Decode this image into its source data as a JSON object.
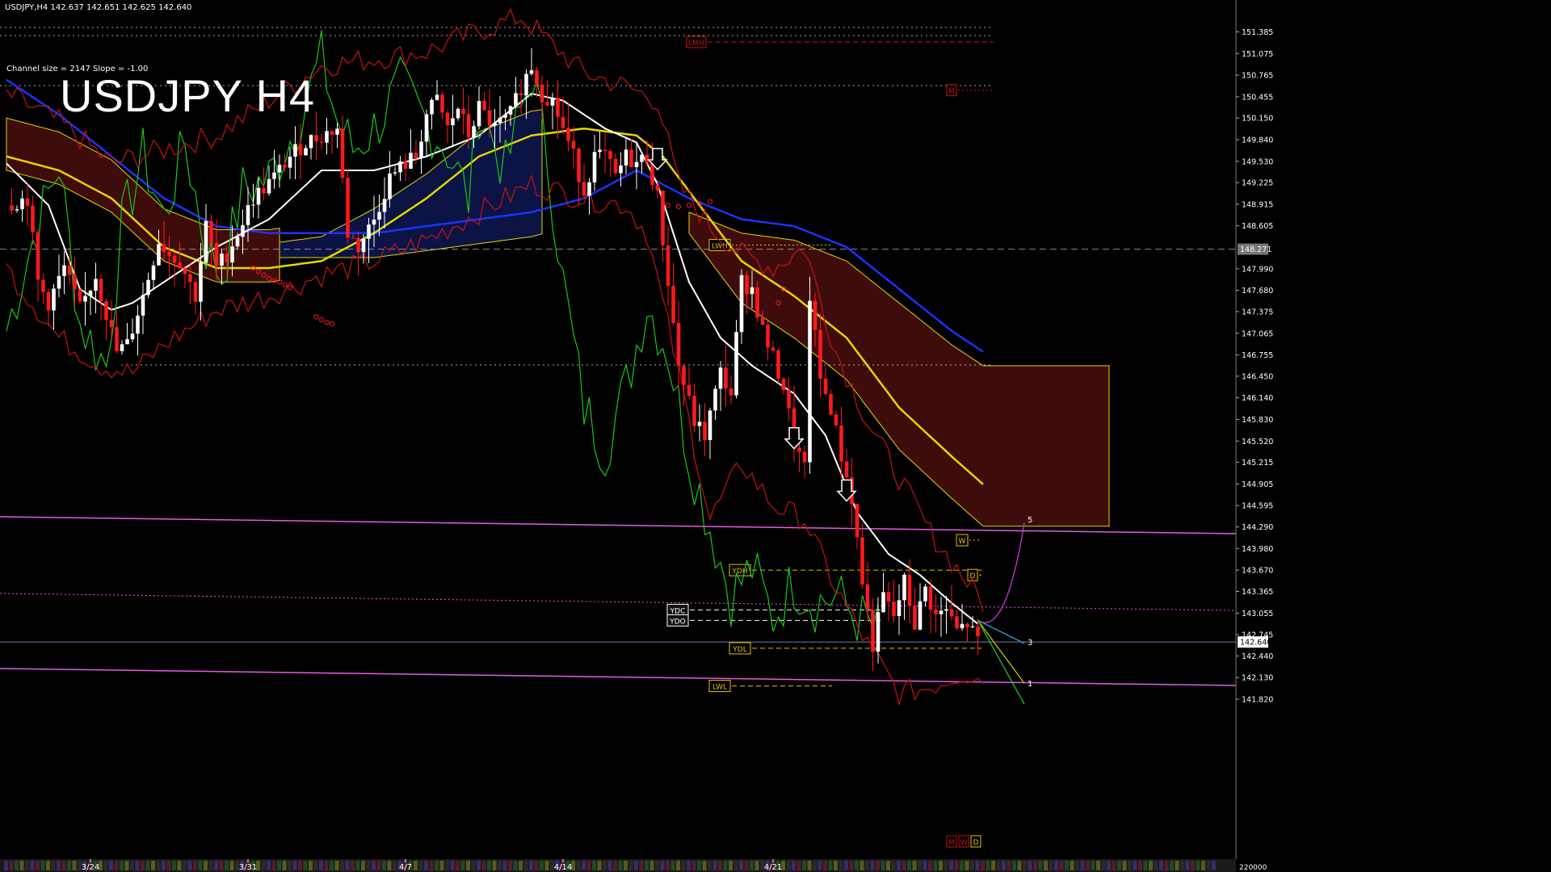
{
  "header": {
    "info": "USDJPY,H4  142.637 142.651 142.625 142.640",
    "channel": "Channel size = 2147 Slope = -1.00",
    "watermark": "USDJPY H4"
  },
  "colors": {
    "background": "#000000",
    "bull_candle": "#ffffff",
    "bear_candle": "#ff1a1a",
    "ma_blue": "#1a33ff",
    "ma_yellow": "#e6d600",
    "ma_white": "#ffffff",
    "oscillator": "#19c919",
    "bands": "#cc1111",
    "kumo_bear": "#8b1a1a",
    "kumo_bull": "#1a2a99",
    "pivot_line": "#e659e6",
    "level_label": "#e6c200"
  },
  "chart_data": {
    "type": "candlestick",
    "symbol": "USDJPY",
    "timeframe": "H4",
    "ylim": [
      141.82,
      151.68
    ],
    "y_ticks": [
      "151.385",
      "151.075",
      "150.765",
      "150.455",
      "150.150",
      "149.840",
      "149.530",
      "149.225",
      "148.915",
      "148.605",
      "147.990",
      "147.680",
      "147.375",
      "147.065",
      "146.755",
      "146.450",
      "146.140",
      "145.830",
      "145.520",
      "145.215",
      "144.905",
      "144.595",
      "144.290",
      "143.980",
      "143.670",
      "143.365",
      "143.055",
      "142.745",
      "142.440",
      "142.130",
      "141.820"
    ],
    "y_tick_values": [
      151.385,
      151.075,
      150.765,
      150.455,
      150.15,
      149.84,
      149.53,
      149.225,
      148.915,
      148.605,
      147.99,
      147.68,
      147.375,
      147.065,
      146.755,
      146.45,
      146.14,
      145.83,
      145.52,
      145.215,
      144.905,
      144.595,
      144.29,
      143.98,
      143.67,
      143.365,
      143.055,
      142.745,
      142.44,
      142.13,
      141.82
    ],
    "current_price": "142.640",
    "current_price_value": 142.64,
    "crosshair_price": "148.271",
    "crosshair_price_value": 148.271,
    "x_labels": [
      {
        "label": "3/24",
        "bar": 16
      },
      {
        "label": "3/31",
        "bar": 46
      },
      {
        "label": "4/7",
        "bar": 76
      },
      {
        "label": "4/14",
        "bar": 106
      },
      {
        "label": "4/21",
        "bar": 146
      }
    ],
    "bars_count": 186,
    "anchors": [
      [
        0,
        148.9
      ],
      [
        4,
        149.0
      ],
      [
        6,
        147.8
      ],
      [
        8,
        147.5
      ],
      [
        11,
        148.0
      ],
      [
        14,
        147.4
      ],
      [
        17,
        147.9
      ],
      [
        21,
        146.8
      ],
      [
        23,
        146.9
      ],
      [
        26,
        147.6
      ],
      [
        29,
        148.4
      ],
      [
        31,
        148.2
      ],
      [
        33,
        148.1
      ],
      [
        36,
        147.6
      ],
      [
        38,
        148.6
      ],
      [
        40,
        148.0
      ],
      [
        42,
        148.2
      ],
      [
        44,
        148.5
      ],
      [
        47,
        149.0
      ],
      [
        51,
        149.3
      ],
      [
        54,
        149.6
      ],
      [
        57,
        149.8
      ],
      [
        60,
        149.9
      ],
      [
        63,
        150.0
      ],
      [
        65,
        148.5
      ],
      [
        67,
        148.3
      ],
      [
        70,
        148.7
      ],
      [
        73,
        149.3
      ],
      [
        76,
        149.5
      ],
      [
        78,
        149.6
      ],
      [
        80,
        150.2
      ],
      [
        82,
        150.4
      ],
      [
        84,
        150.0
      ],
      [
        86,
        150.3
      ],
      [
        88,
        149.9
      ],
      [
        90,
        150.3
      ],
      [
        93,
        150.0
      ],
      [
        96,
        150.2
      ],
      [
        98,
        150.6
      ],
      [
        100,
        150.9
      ],
      [
        102,
        150.5
      ],
      [
        104,
        150.4
      ],
      [
        106,
        150.0
      ],
      [
        108,
        149.6
      ],
      [
        110,
        149.1
      ],
      [
        112,
        149.6
      ],
      [
        114,
        149.6
      ],
      [
        116,
        149.3
      ],
      [
        118,
        149.6
      ],
      [
        120,
        149.5
      ],
      [
        122,
        149.6
      ],
      [
        124,
        149.0
      ],
      [
        126,
        147.8
      ],
      [
        128,
        146.6
      ],
      [
        131,
        145.8
      ],
      [
        133,
        145.6
      ],
      [
        136,
        146.5
      ],
      [
        138,
        146.2
      ],
      [
        140,
        147.8
      ],
      [
        142,
        147.7
      ],
      [
        144,
        147.1
      ],
      [
        146,
        146.7
      ],
      [
        148,
        146.3
      ],
      [
        150,
        145.5
      ],
      [
        152,
        145.1
      ],
      [
        153,
        147.6
      ],
      [
        155,
        146.4
      ],
      [
        157,
        146.0
      ],
      [
        159,
        145.3
      ],
      [
        161,
        144.7
      ],
      [
        163,
        143.5
      ],
      [
        165,
        142.6
      ],
      [
        167,
        143.3
      ],
      [
        169,
        143.0
      ],
      [
        171,
        143.5
      ],
      [
        173,
        142.9
      ],
      [
        175,
        143.4
      ],
      [
        177,
        143.0
      ],
      [
        179,
        143.1
      ],
      [
        181,
        142.8
      ],
      [
        183,
        142.9
      ],
      [
        185,
        142.64
      ]
    ],
    "series": [
      {
        "name": "",
        "color": "#1a33ff",
        "type": "moving_average",
        "anchors": [
          [
            0,
            150.7
          ],
          [
            10,
            150.2
          ],
          [
            20,
            149.6
          ],
          [
            30,
            149.0
          ],
          [
            40,
            148.6
          ],
          [
            50,
            148.5
          ],
          [
            60,
            148.5
          ],
          [
            70,
            148.5
          ],
          [
            80,
            148.6
          ],
          [
            90,
            148.7
          ],
          [
            100,
            148.8
          ],
          [
            110,
            149.0
          ],
          [
            120,
            149.4
          ],
          [
            125,
            149.2
          ],
          [
            130,
            149.0
          ],
          [
            140,
            148.7
          ],
          [
            150,
            148.6
          ],
          [
            160,
            148.3
          ],
          [
            170,
            147.7
          ],
          [
            180,
            147.1
          ],
          [
            186,
            146.8
          ]
        ]
      },
      {
        "name": "",
        "color": "#e6d600",
        "type": "moving_average",
        "anchors": [
          [
            0,
            149.6
          ],
          [
            10,
            149.4
          ],
          [
            20,
            149.0
          ],
          [
            30,
            148.3
          ],
          [
            40,
            148.0
          ],
          [
            50,
            148.0
          ],
          [
            60,
            148.1
          ],
          [
            70,
            148.5
          ],
          [
            80,
            149.0
          ],
          [
            90,
            149.6
          ],
          [
            100,
            149.9
          ],
          [
            110,
            150.0
          ],
          [
            120,
            149.9
          ],
          [
            125,
            149.6
          ],
          [
            130,
            149.1
          ],
          [
            140,
            148.1
          ],
          [
            150,
            147.6
          ],
          [
            160,
            147.0
          ],
          [
            170,
            146.0
          ],
          [
            180,
            145.3
          ],
          [
            186,
            144.9
          ]
        ]
      },
      {
        "name": "",
        "color": "#ffffff",
        "type": "moving_average",
        "anchors": [
          [
            0,
            149.5
          ],
          [
            8,
            148.9
          ],
          [
            14,
            147.7
          ],
          [
            20,
            147.4
          ],
          [
            24,
            147.5
          ],
          [
            30,
            147.8
          ],
          [
            40,
            148.3
          ],
          [
            50,
            148.7
          ],
          [
            60,
            149.4
          ],
          [
            70,
            149.4
          ],
          [
            80,
            149.6
          ],
          [
            90,
            149.9
          ],
          [
            100,
            150.5
          ],
          [
            106,
            150.4
          ],
          [
            114,
            150.0
          ],
          [
            120,
            149.8
          ],
          [
            124,
            149.2
          ],
          [
            130,
            147.8
          ],
          [
            136,
            147.0
          ],
          [
            142,
            146.6
          ],
          [
            150,
            146.2
          ],
          [
            156,
            145.6
          ],
          [
            162,
            144.5
          ],
          [
            168,
            143.9
          ],
          [
            174,
            143.6
          ],
          [
            180,
            143.2
          ],
          [
            185,
            142.9
          ]
        ]
      },
      {
        "name": "",
        "color": "#19c919",
        "type": "oscillator",
        "anchors": [
          [
            0,
            147.1
          ],
          [
            5,
            148.4
          ],
          [
            10,
            149.5
          ],
          [
            14,
            147.2
          ],
          [
            19,
            146.6
          ],
          [
            22,
            148.6
          ],
          [
            26,
            149.6
          ],
          [
            30,
            148.7
          ],
          [
            34,
            149.8
          ],
          [
            38,
            148.3
          ],
          [
            41,
            147.9
          ],
          [
            45,
            149.1
          ],
          [
            50,
            149.3
          ],
          [
            55,
            150.0
          ],
          [
            60,
            151.0
          ],
          [
            63,
            150.1
          ],
          [
            66,
            149.7
          ],
          [
            70,
            150.0
          ],
          [
            75,
            150.6
          ],
          [
            80,
            150.1
          ],
          [
            84,
            149.7
          ],
          [
            88,
            149.0
          ],
          [
            90,
            150.3
          ],
          [
            95,
            149.4
          ],
          [
            100,
            150.8
          ],
          [
            103,
            149.6
          ],
          [
            106,
            147.8
          ],
          [
            110,
            146.0
          ],
          [
            114,
            145.4
          ],
          [
            118,
            146.3
          ],
          [
            122,
            147.5
          ],
          [
            126,
            146.8
          ],
          [
            130,
            145.3
          ],
          [
            134,
            144.3
          ],
          [
            138,
            143.3
          ],
          [
            142,
            143.7
          ],
          [
            146,
            143.0
          ],
          [
            150,
            143.5
          ],
          [
            154,
            143.2
          ],
          [
            158,
            143.3
          ],
          [
            162,
            143.0
          ],
          [
            166,
            142.8
          ]
        ]
      },
      {
        "name": "",
        "color": "#cc1111",
        "type": "band_upper",
        "anchors": [
          [
            0,
            150.5
          ],
          [
            10,
            150.1
          ],
          [
            20,
            149.5
          ],
          [
            30,
            149.7
          ],
          [
            40,
            149.9
          ],
          [
            50,
            150.4
          ],
          [
            60,
            150.9
          ],
          [
            70,
            151.0
          ],
          [
            80,
            151.1
          ],
          [
            90,
            151.4
          ],
          [
            98,
            151.6
          ],
          [
            104,
            151.2
          ],
          [
            110,
            150.8
          ],
          [
            118,
            150.6
          ],
          [
            124,
            150.4
          ],
          [
            128,
            149.2
          ],
          [
            134,
            148.6
          ],
          [
            140,
            148.2
          ],
          [
            146,
            148.0
          ],
          [
            152,
            148.3
          ],
          [
            158,
            146.8
          ],
          [
            164,
            145.8
          ],
          [
            170,
            145.0
          ],
          [
            176,
            144.2
          ],
          [
            182,
            143.6
          ],
          [
            186,
            143.2
          ]
        ]
      },
      {
        "name": "",
        "color": "#cc1111",
        "type": "band_lower",
        "anchors": [
          [
            0,
            148.0
          ],
          [
            10,
            147.0
          ],
          [
            18,
            146.6
          ],
          [
            24,
            146.5
          ],
          [
            30,
            146.9
          ],
          [
            40,
            147.4
          ],
          [
            50,
            147.6
          ],
          [
            60,
            147.9
          ],
          [
            70,
            148.1
          ],
          [
            80,
            148.4
          ],
          [
            90,
            148.8
          ],
          [
            100,
            149.2
          ],
          [
            110,
            149.0
          ],
          [
            118,
            148.9
          ],
          [
            122,
            148.5
          ],
          [
            128,
            146.5
          ],
          [
            134,
            144.4
          ],
          [
            140,
            145.2
          ],
          [
            146,
            144.6
          ],
          [
            152,
            144.4
          ],
          [
            158,
            143.4
          ],
          [
            164,
            142.6
          ],
          [
            170,
            141.9
          ],
          [
            176,
            142.0
          ],
          [
            182,
            142.2
          ],
          [
            186,
            142.1
          ]
        ]
      }
    ],
    "horizontal_levels": [
      {
        "label": "LMH",
        "value": 151.24,
        "color": "#cc1111",
        "style": "dashed"
      },
      {
        "label": "M",
        "value": 150.55,
        "color": "#cc1111",
        "style": "dotted"
      },
      {
        "label": "LWH",
        "value": 148.33,
        "color": "#e6c200",
        "style": "dotted"
      },
      {
        "label": "W",
        "value": 144.1,
        "color": "#e6c200",
        "style": "dotted"
      },
      {
        "label": "YDH",
        "value": 143.67,
        "color": "#e6c200",
        "style": "dashed"
      },
      {
        "label": "D",
        "value": 143.6,
        "color": "#e6c200",
        "style": "dashed"
      },
      {
        "label": "YDC",
        "value": 143.1,
        "color": "#ffffff",
        "style": "dashed"
      },
      {
        "label": "YDO",
        "value": 142.95,
        "color": "#ffffff",
        "style": "dashed"
      },
      {
        "label": "YDL",
        "value": 142.55,
        "color": "#e6c200",
        "style": "dashed"
      },
      {
        "label": "LWL",
        "value": 142.01,
        "color": "#e6c200",
        "style": "dashed"
      }
    ],
    "bottom_tags": [
      "M",
      "W",
      "D"
    ],
    "projection_labels": [
      "5",
      "3",
      "1"
    ],
    "arrows": [
      {
        "bar": 124,
        "value": 149.55,
        "direction": "down"
      },
      {
        "bar": 150,
        "value": 145.55,
        "direction": "down"
      },
      {
        "bar": 160,
        "value": 144.8,
        "direction": "down"
      }
    ],
    "volume_label": "220000"
  }
}
